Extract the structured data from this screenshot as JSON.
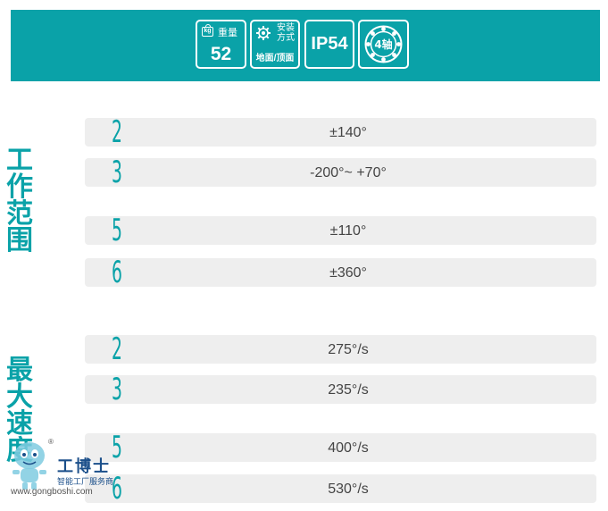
{
  "header": {
    "weight": {
      "icon": "kg-icon",
      "icon_text": "kg",
      "label": "重量",
      "value": "52"
    },
    "mount": {
      "icon": "gear-wrench-icon",
      "label": "安装\n方式",
      "value": "地面/顶面"
    },
    "ip": {
      "value": "IP54"
    },
    "axis": {
      "icon": "axis-ring-icon",
      "value": "4轴"
    }
  },
  "work_range": {
    "title": "工作范围",
    "rows": [
      {
        "axis": "2",
        "value": "±140°"
      },
      {
        "axis": "3",
        "value": "-200°~ +70°"
      },
      {
        "axis": "5",
        "value": "±110°"
      },
      {
        "axis": "6",
        "value": "±360°"
      }
    ]
  },
  "max_speed": {
    "title": "最大速度",
    "rows": [
      {
        "axis": "2",
        "value": "275°/s"
      },
      {
        "axis": "3",
        "value": "235°/s"
      },
      {
        "axis": "5",
        "value": "400°/s"
      },
      {
        "axis": "6",
        "value": "530°/s"
      }
    ]
  },
  "watermark": {
    "brand": "工博士",
    "tagline": "智能工厂服务商",
    "url": "www.gongboshi.com",
    "registered": "®"
  },
  "colors": {
    "accent": "#0aa2a8",
    "row_bg": "#eeeeee",
    "text": "#444444"
  }
}
